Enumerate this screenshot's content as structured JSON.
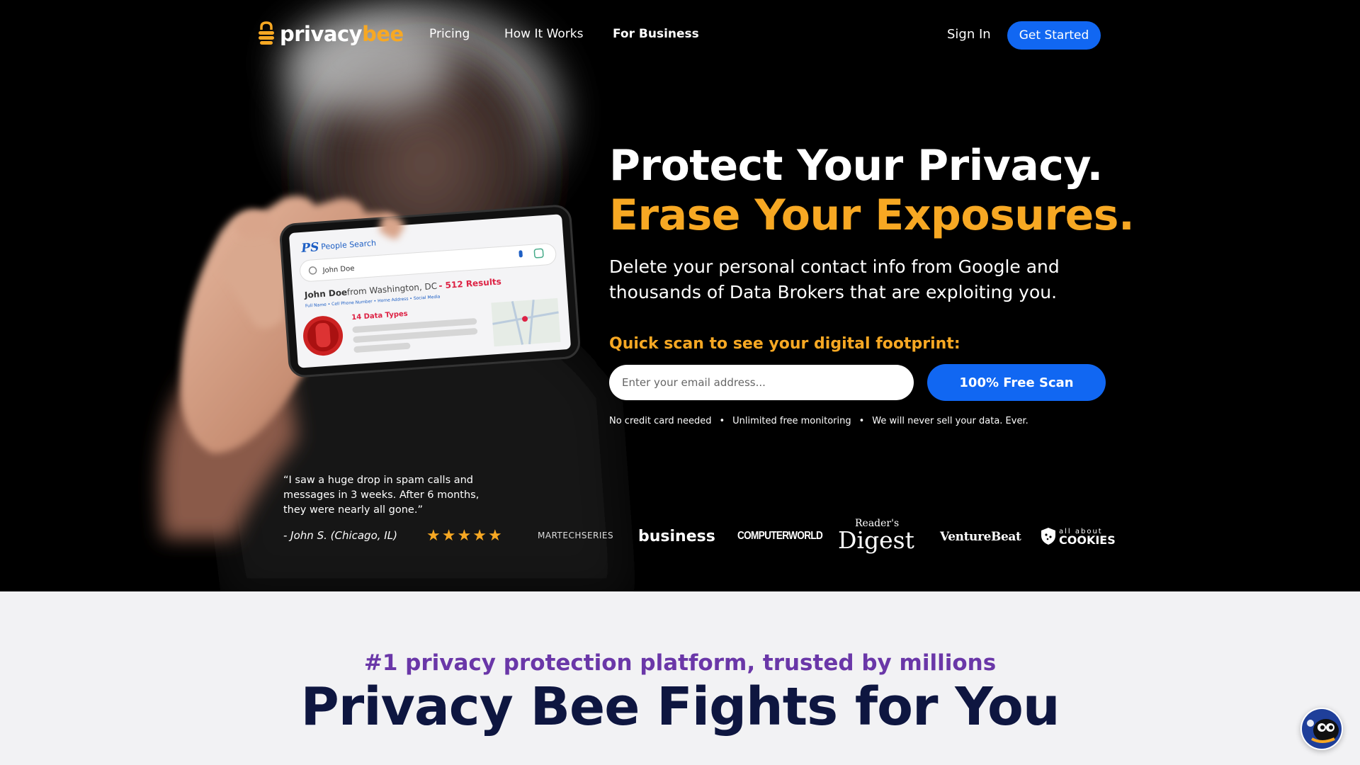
{
  "brand": {
    "name_part1": "privacy",
    "name_part2": "bee",
    "accent": "#f7a823",
    "primary": "#1167f2"
  },
  "nav": {
    "links": [
      "Pricing",
      "How It Works",
      "For Business"
    ],
    "sign_in": "Sign In",
    "get_started": "Get Started"
  },
  "hero": {
    "headline_1": "Protect Your Privacy.",
    "headline_2": "Erase Your Exposures.",
    "subheadline": "Delete your personal contact info from Google and thousands of Data Brokers that are exploiting you.",
    "quick_scan_label": "Quick scan to see your digital footprint:",
    "email_placeholder": "Enter your email address...",
    "scan_button": "100% Free Scan",
    "features": [
      "No credit card needed",
      "Unlimited free monitoring",
      "We will never sell your data. Ever."
    ],
    "feature_separator": "•"
  },
  "phone_screen": {
    "app_logo": "PS",
    "app_name": "People Search",
    "search_value": "John Doe",
    "result_name": "John Doe",
    "result_location": "from Washington, DC",
    "result_count": "- 512 Results",
    "result_fields": "Full Name  •  Cell Phone Number  •  Home Address  •  Social Media",
    "data_types": "14 Data Types"
  },
  "testimonial": {
    "quote": "“I saw a huge drop in spam calls and messages in 3 weeks. After 6 months, they were nearly all gone.”",
    "author": "- John S. (Chicago, IL)",
    "rating": 5,
    "star_glyph": "★"
  },
  "press": {
    "martech": "MARTECHSERIES",
    "business": "business",
    "computerworld": "COMPUTERWORLD",
    "readers": "Reader's",
    "digest": "Digest",
    "venturebeat": "VentureBeat",
    "cookies_small": "all about",
    "cookies_big": "COOKIES"
  },
  "section": {
    "tagline": "#1 privacy protection platform, trusted by millions",
    "title": "Privacy Bee Fights for You"
  },
  "icons": {
    "logo": "bee-lock-icon",
    "chat": "chat-support-icon",
    "search": "search-icon",
    "mic": "microphone-icon",
    "lens": "camera-lens-icon"
  }
}
